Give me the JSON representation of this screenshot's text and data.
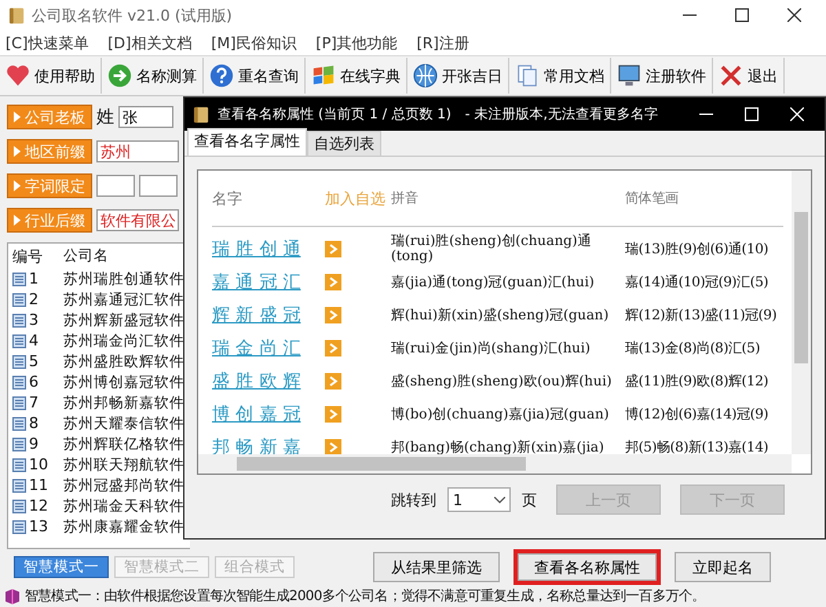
{
  "window": {
    "title": "公司取名软件 v21.0 (试用版)"
  },
  "menu": [
    "[C]快速菜单",
    "[D]相关文档",
    "[M]民俗知识",
    "[P]其他功能",
    "[R]注册"
  ],
  "toolbar": [
    {
      "label": "使用帮助"
    },
    {
      "label": "名称测算"
    },
    {
      "label": "重名查询"
    },
    {
      "label": "在线字典"
    },
    {
      "label": "开张吉日"
    },
    {
      "label": "常用文档"
    },
    {
      "label": "注册软件"
    },
    {
      "label": "退出"
    }
  ],
  "form": {
    "surname_button": "公司老板",
    "surname_label": "姓",
    "surname_value": "张",
    "region_button": "地区前缀",
    "region_value": "苏州",
    "words_button": "字词限定",
    "suffix_button": "行业后缀",
    "suffix_value": "软件有限公"
  },
  "results": {
    "columns": [
      "编号",
      "公司名"
    ],
    "rows": [
      [
        "1",
        "苏州瑞胜创通软件"
      ],
      [
        "2",
        "苏州嘉通冠汇软件"
      ],
      [
        "3",
        "苏州辉新盛冠软件"
      ],
      [
        "4",
        "苏州瑞金尚汇软件"
      ],
      [
        "5",
        "苏州盛胜欧辉软件"
      ],
      [
        "6",
        "苏州博创嘉冠软件"
      ],
      [
        "7",
        "苏州邦畅新嘉软件"
      ],
      [
        "8",
        "苏州天耀泰信软件"
      ],
      [
        "9",
        "苏州辉联亿格软件"
      ],
      [
        "10",
        "苏州联天翔航软件"
      ],
      [
        "11",
        "苏州冠盛邦尚软件"
      ],
      [
        "12",
        "苏州瑞金天科软件"
      ],
      [
        "13",
        "苏州康嘉耀金软件"
      ]
    ]
  },
  "modes": [
    {
      "label": "智慧模式一",
      "selected": true
    },
    {
      "label": "智慧模式二",
      "selected": false
    },
    {
      "label": "组合模式",
      "selected": false
    }
  ],
  "actions": [
    {
      "label": "从结果里筛选",
      "highlighted": false
    },
    {
      "label": "查看各名称属性",
      "highlighted": true
    },
    {
      "label": "立即起名",
      "highlighted": false
    }
  ],
  "status": "智慧模式一：由软件根据您设置每次智能生成2000多个公司名；觉得不满意可重复生成，名称总量达到一百多万个。",
  "dialog": {
    "title": "查看各名称属性 (当前页 1 / 总页数 1)　- 未注册版本,无法查看更多名字",
    "tabs": [
      {
        "label": "查看各名字属性",
        "selected": true
      },
      {
        "label": "自选列表",
        "selected": false
      }
    ],
    "columns": [
      "名字",
      "加入自选",
      "拼音",
      "简体笔画"
    ],
    "rows": [
      {
        "name": "瑞 胜 创 通",
        "pinyin": "瑞(rui)胜(sheng)创(chuang)通(tong)",
        "strokes": "瑞(13)胜(9)创(6)通(10)"
      },
      {
        "name": "嘉 通 冠 汇",
        "pinyin": "嘉(jia)通(tong)冠(guan)汇(hui)",
        "strokes": "嘉(14)通(10)冠(9)汇(5)"
      },
      {
        "name": "辉 新 盛 冠",
        "pinyin": "辉(hui)新(xin)盛(sheng)冠(guan)",
        "strokes": "辉(12)新(13)盛(11)冠(9)"
      },
      {
        "name": "瑞 金 尚 汇",
        "pinyin": "瑞(rui)金(jin)尚(shang)汇(hui)",
        "strokes": "瑞(13)金(8)尚(8)汇(5)"
      },
      {
        "name": "盛 胜 欧 辉",
        "pinyin": "盛(sheng)胜(sheng)欧(ou)辉(hui)",
        "strokes": "盛(11)胜(9)欧(8)辉(12)"
      },
      {
        "name": "博 创 嘉 冠",
        "pinyin": "博(bo)创(chuang)嘉(jia)冠(guan)",
        "strokes": "博(12)创(6)嘉(14)冠(9)"
      },
      {
        "name": "邦 畅 新 嘉",
        "pinyin": "邦(bang)畅(chang)新(xin)嘉(jia)",
        "strokes": "邦(5)畅(8)新(13)嘉(14)"
      }
    ],
    "jump_label": "跳转到",
    "page_value": "1",
    "page_unit": "页",
    "pager": [
      {
        "label": "上一页",
        "disabled": true
      },
      {
        "label": "下一页",
        "disabled": true
      }
    ]
  }
}
